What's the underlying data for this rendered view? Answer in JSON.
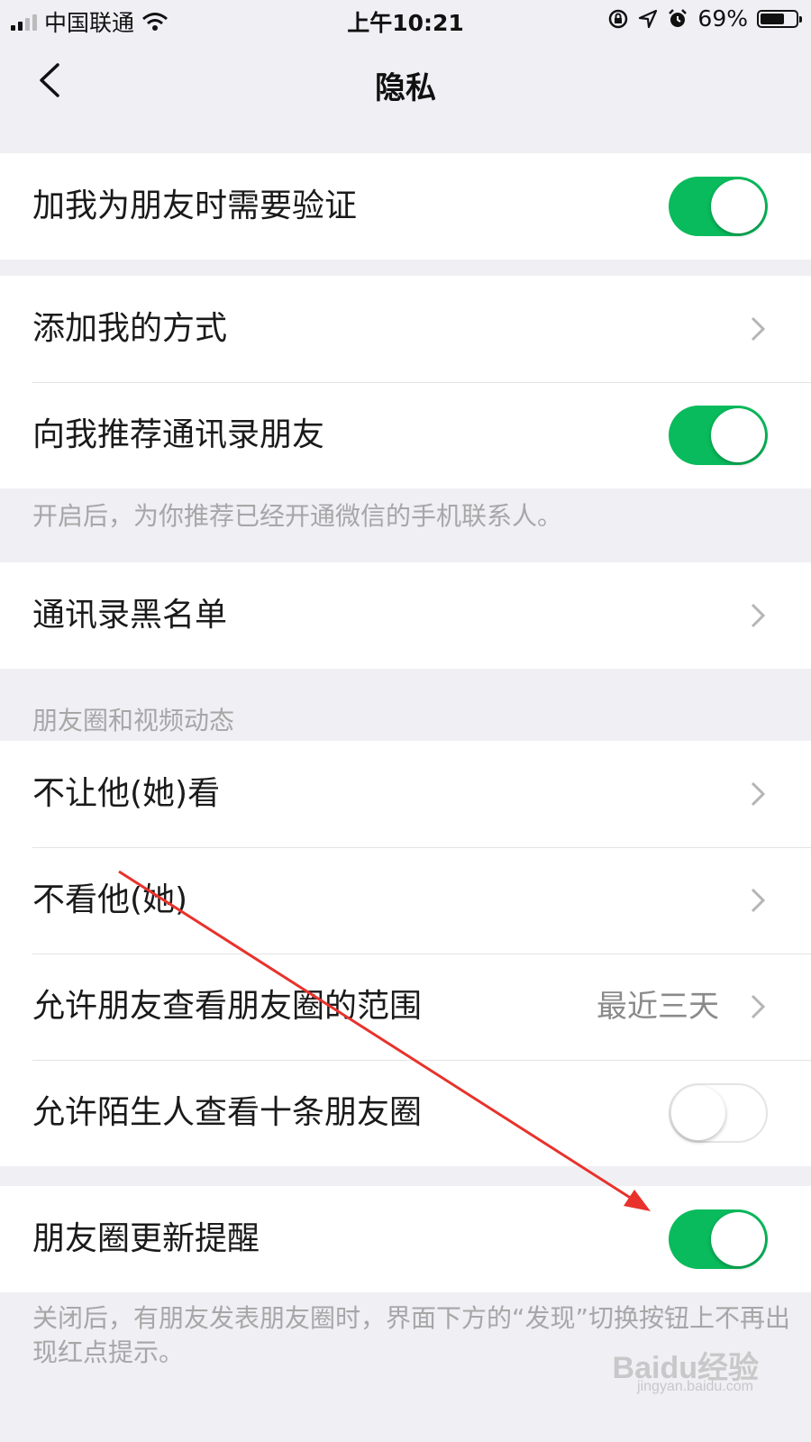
{
  "status": {
    "carrier": "中国联通",
    "time": "上午10:21",
    "battery": "69%",
    "battery_level": 0.69,
    "icons": [
      "signal-icon",
      "wifi-icon",
      "rotation-lock-icon",
      "location-icon",
      "alarm-icon",
      "battery-icon"
    ]
  },
  "nav": {
    "title": "隐私",
    "back_icon": "back-chevron-icon"
  },
  "groups": {
    "verify": {
      "label": "加我为朋友时需要验证",
      "toggle": true
    },
    "add_methods": {
      "label": "添加我的方式"
    },
    "recommend_contacts": {
      "label": "向我推荐通讯录朋友",
      "toggle": true
    },
    "recommend_hint": "开启后，为你推荐已经开通微信的手机联系人。",
    "blacklist": {
      "label": "通讯录黑名单"
    },
    "moments_header": "朋友圈和视频动态",
    "hide_my_posts": {
      "label": "不让他(她)看"
    },
    "hide_their_posts": {
      "label": "不看他(她)"
    },
    "visible_range": {
      "label": "允许朋友查看朋友圈的范围",
      "value": "最近三天"
    },
    "stranger_ten_posts": {
      "label": "允许陌生人查看十条朋友圈",
      "toggle": false
    },
    "moments_update_reminder": {
      "label": "朋友圈更新提醒",
      "toggle": true
    },
    "reminder_hint": "关闭后，有朋友发表朋友圈时，界面下方的“发现”切换按钮上不再出现红点提示。"
  },
  "colors": {
    "accent": "#09bb5c",
    "annotation_arrow": "#e8322b",
    "background": "#efeff4"
  },
  "watermark": {
    "brand": "Baidu经验",
    "url": "jingyan.baidu.com"
  }
}
